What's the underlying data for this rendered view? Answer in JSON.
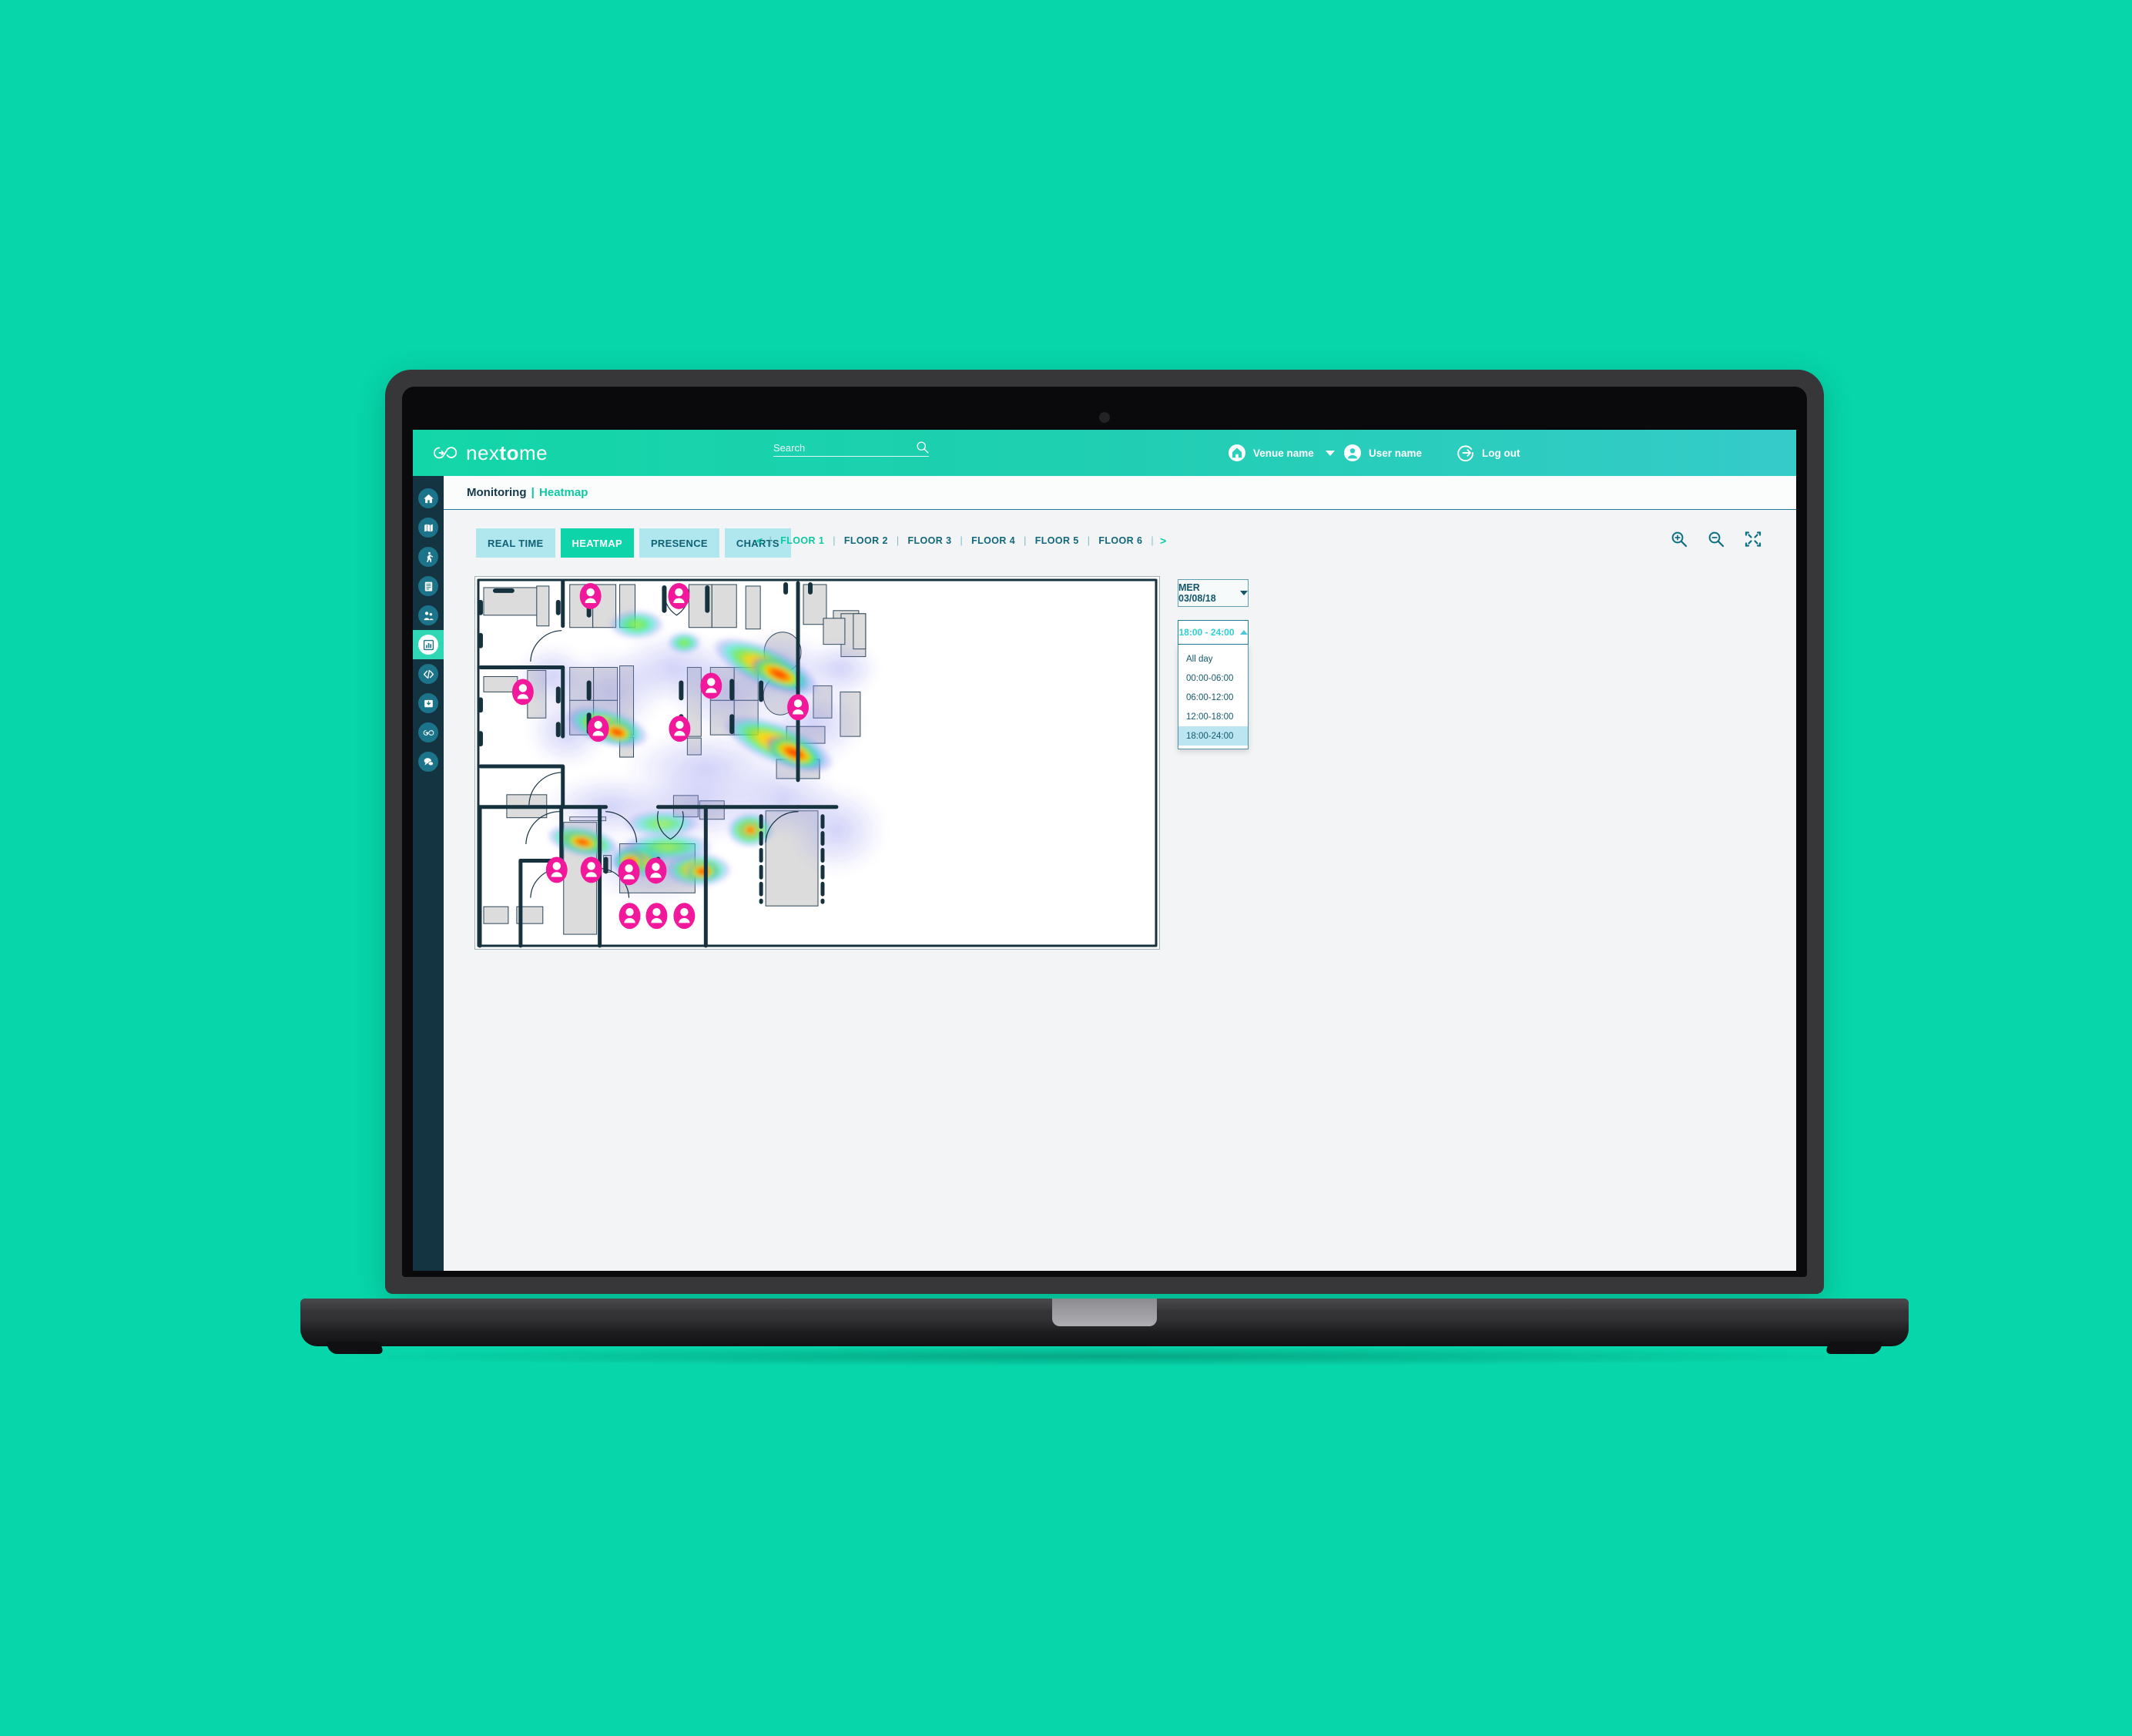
{
  "brand": {
    "name_light": "nex",
    "name_bold": "to",
    "name_tail": "me",
    "logo_icon": "nextome-infinity-icon",
    "accent": "#0ed4aa",
    "page_bg": "#07d6aa"
  },
  "header": {
    "search_placeholder": "Search",
    "search_value": "",
    "search_icon": "search-icon",
    "venue": {
      "label": "Venue name",
      "icon": "home-icon"
    },
    "user": {
      "label": "User name",
      "icon": "user-icon"
    },
    "logout": {
      "label": "Log out",
      "icon": "logout-arrow-icon"
    }
  },
  "breadcrumb": {
    "section": "Monitoring",
    "separator": "|",
    "current": "Heatmap"
  },
  "sidebar": {
    "items": [
      {
        "name": "home",
        "icon": "home-icon",
        "active": false
      },
      {
        "name": "maps",
        "icon": "map-icon",
        "active": false
      },
      {
        "name": "tracking",
        "icon": "walking-person-icon",
        "active": false
      },
      {
        "name": "reports",
        "icon": "document-icon",
        "active": false
      },
      {
        "name": "people",
        "icon": "people-icon",
        "active": false
      },
      {
        "name": "monitoring",
        "icon": "analytics-chart-icon",
        "active": true
      },
      {
        "name": "developers",
        "icon": "code-icon",
        "active": false
      },
      {
        "name": "downloads",
        "icon": "box-download-icon",
        "active": false
      },
      {
        "name": "nextome",
        "icon": "nextome-infinity-icon",
        "active": false
      },
      {
        "name": "messages",
        "icon": "chat-bubbles-icon",
        "active": false
      }
    ]
  },
  "tabs": [
    {
      "label": "REAL TIME",
      "active": false
    },
    {
      "label": "HEATMAP",
      "active": true
    },
    {
      "label": "PRESENCE",
      "active": false
    },
    {
      "label": "CHARTS",
      "active": false
    }
  ],
  "floor_nav": {
    "prev": "<",
    "next": ">",
    "separator": "|",
    "floors": [
      {
        "label": "FLOOR 1",
        "active": true
      },
      {
        "label": "FLOOR 2",
        "active": false
      },
      {
        "label": "FLOOR 3",
        "active": false
      },
      {
        "label": "FLOOR 4",
        "active": false
      },
      {
        "label": "FLOOR 5",
        "active": false
      },
      {
        "label": "FLOOR 6",
        "active": false
      }
    ]
  },
  "zoom_tools": [
    {
      "name": "zoom-in-icon"
    },
    {
      "name": "zoom-out-icon"
    },
    {
      "name": "fit-to-screen-icon"
    }
  ],
  "date_selector": {
    "value": "MER 03/08/18",
    "icon": "chevron-down-icon"
  },
  "time_selector": {
    "value": "18:00 - 24:00",
    "icon": "chevron-up-icon",
    "expanded": true,
    "options": [
      {
        "label": "All day",
        "selected": false
      },
      {
        "label": "00:00-06:00",
        "selected": false
      },
      {
        "label": "06:00-12:00",
        "selected": false
      },
      {
        "label": "12:00-18:00",
        "selected": false
      },
      {
        "label": "18:00-24:00",
        "selected": true
      }
    ]
  },
  "heatmap": {
    "markers_count": 14,
    "marker_color": "#f2189b",
    "wall_color": "#17323f",
    "furniture_color": "#dcdcdc"
  }
}
